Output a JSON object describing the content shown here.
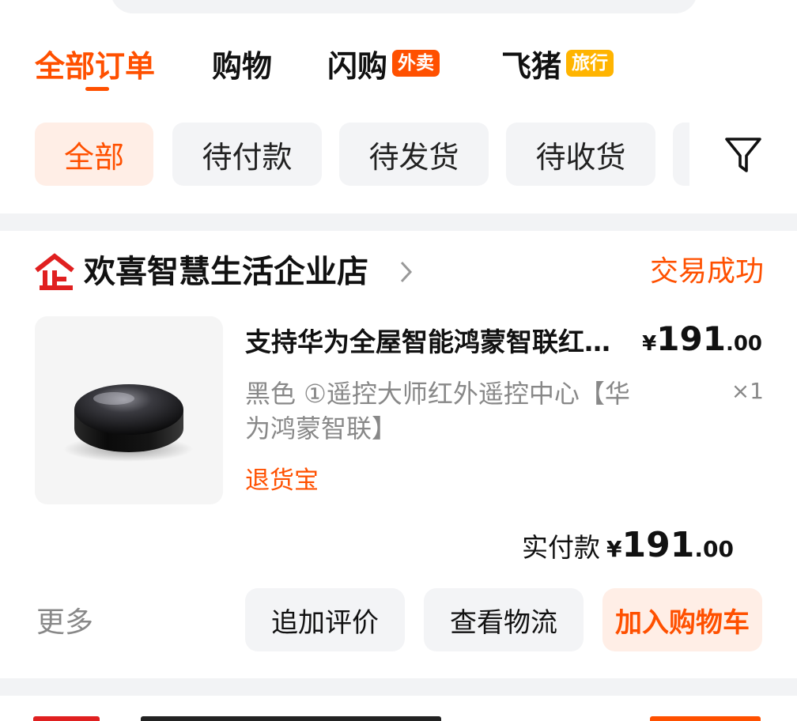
{
  "tabs": [
    {
      "label": "全部订单"
    },
    {
      "label": "购物"
    },
    {
      "label": "闪购",
      "badge": "外卖"
    },
    {
      "label": "飞猪",
      "badge": "旅行"
    }
  ],
  "chips": [
    {
      "label": "全部"
    },
    {
      "label": "待付款"
    },
    {
      "label": "待发货"
    },
    {
      "label": "待收货"
    }
  ],
  "filter": {
    "icon": "filter-icon"
  },
  "order": {
    "shop_logo_text": "企",
    "shop_name": "欢喜智慧生活企业店",
    "status": "交易成功",
    "product": {
      "title": "支持华为全屋智能鸿蒙智联红外遥控器",
      "currency": "¥",
      "price_int": "191",
      "price_dec": ".00",
      "sku": "黑色 ①遥控大师红外遥控中心【华为鸿蒙智联】",
      "qty": "×1",
      "return_tag": "退货宝"
    },
    "paid": {
      "label": "实付款",
      "currency": "¥",
      "int": "191",
      "dec": ".00"
    },
    "more": "更多",
    "actions": [
      {
        "label": "追加评价"
      },
      {
        "label": "查看物流"
      },
      {
        "label": "加入购物车"
      }
    ]
  },
  "colors": {
    "accent": "#ff5000",
    "badge_orange": "#ff5000",
    "badge_yellow": "#ffb400",
    "chip_bg": "#f3f4f6",
    "active_chip_bg": "#ffeee6"
  }
}
